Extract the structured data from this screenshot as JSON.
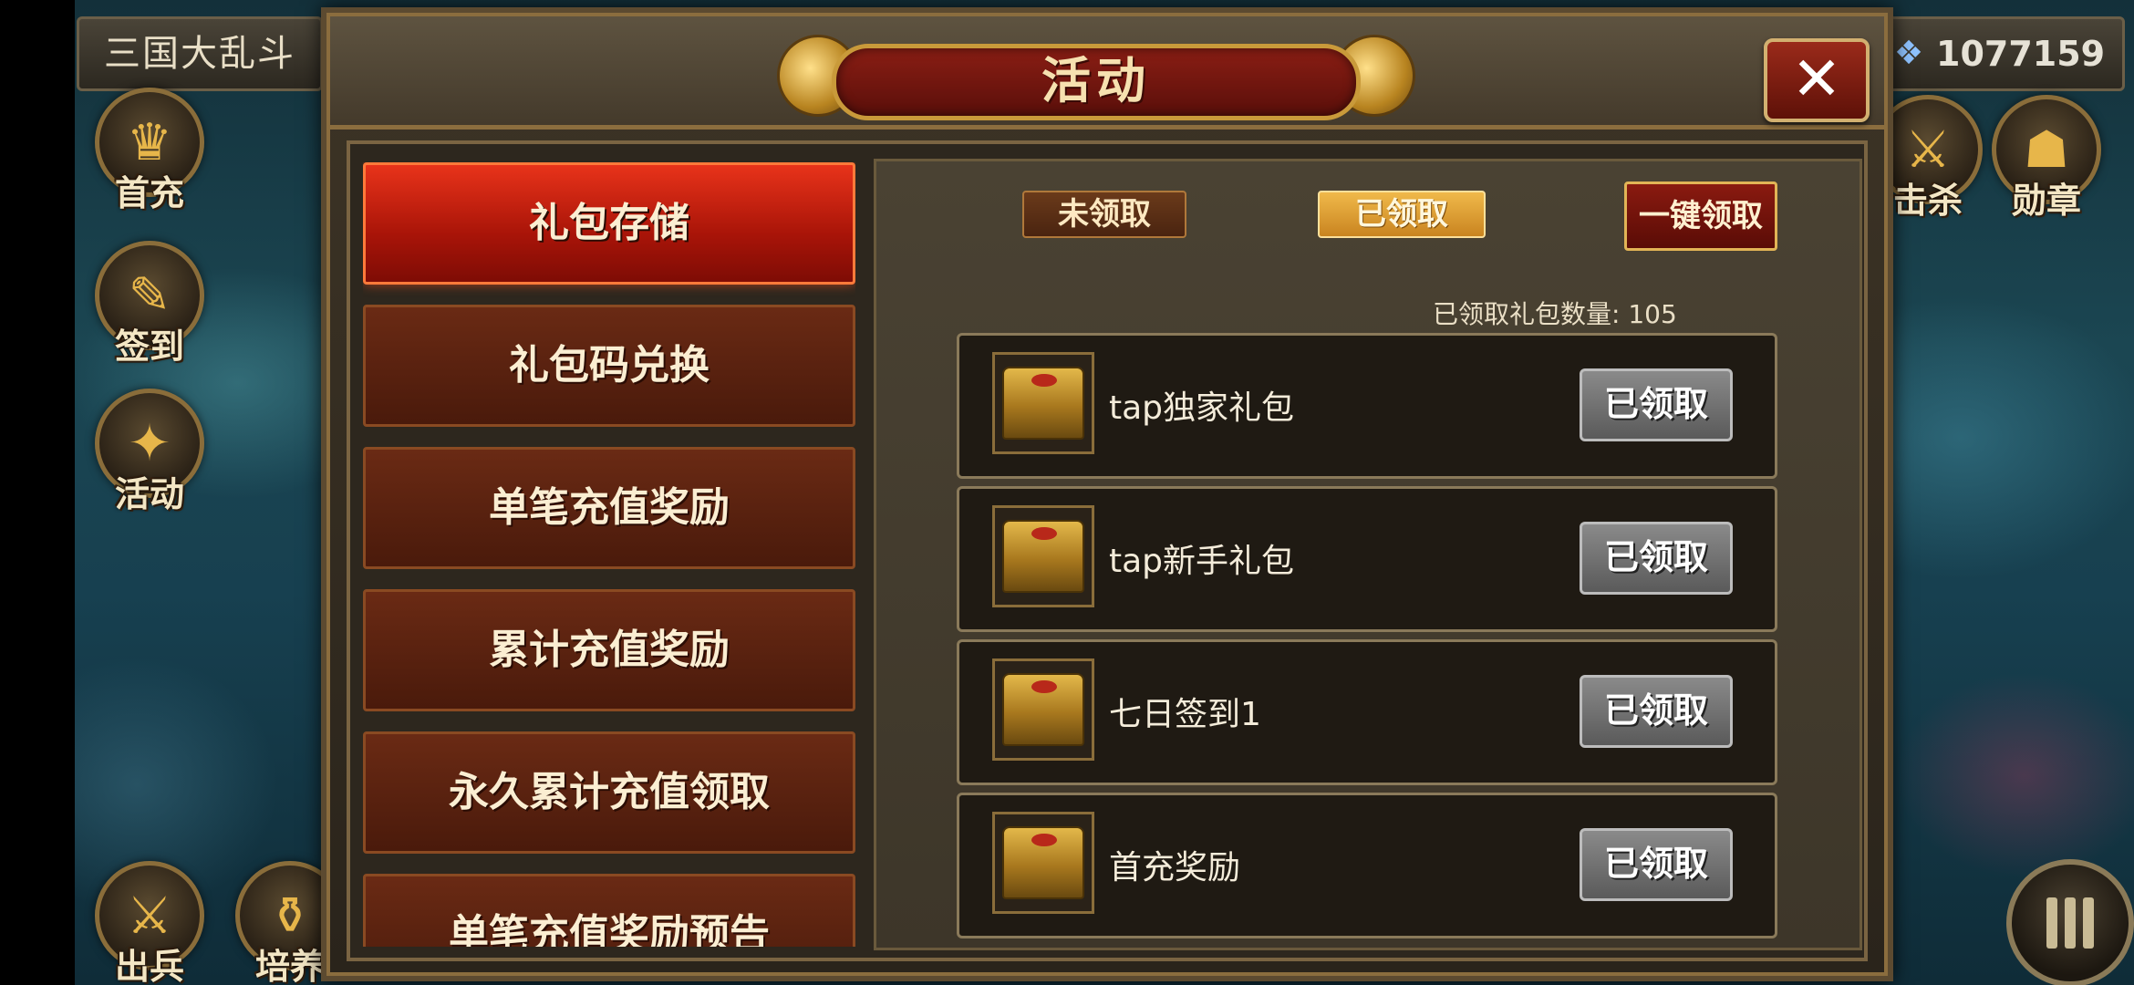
{
  "game_title": "三国大乱斗",
  "currency": {
    "icon": "gem-icon",
    "amount": "1077159"
  },
  "side_icons_left": [
    {
      "label": "首充",
      "icon": "first-charge-icon"
    },
    {
      "label": "签到",
      "icon": "checkin-icon"
    },
    {
      "label": "活动",
      "icon": "activity-icon"
    },
    {
      "label": "出兵",
      "icon": "deploy-icon"
    },
    {
      "label": "培养",
      "icon": "cultivate-icon"
    }
  ],
  "side_icons_right": [
    {
      "label": "击杀",
      "icon": "kill-icon"
    },
    {
      "label": "勋章",
      "icon": "medal-icon"
    }
  ],
  "dialog": {
    "title": "活动",
    "close": "✕",
    "tabs": [
      {
        "label": "礼包存储",
        "active": true
      },
      {
        "label": "礼包码兑换",
        "active": false
      },
      {
        "label": "单笔充值奖励",
        "active": false
      },
      {
        "label": "累计充值奖励",
        "active": false
      },
      {
        "label": "永久累计充值领取",
        "active": false
      },
      {
        "label": "单笔充值奖励预告",
        "active": false
      }
    ],
    "filters": {
      "unclaimed": "未领取",
      "claimed": "已领取"
    },
    "claim_all": "一键领取",
    "claimed_count": "已领取礼包数量: 105",
    "rewards": [
      {
        "name": "tap独家礼包",
        "status": "已领取",
        "icon": "treasure-chest-icon"
      },
      {
        "name": "tap新手礼包",
        "status": "已领取",
        "icon": "treasure-chest-icon"
      },
      {
        "name": "七日签到1",
        "status": "已领取",
        "icon": "treasure-chest-icon"
      },
      {
        "name": "首充奖励",
        "status": "已领取",
        "icon": "treasure-chest-icon"
      }
    ]
  },
  "colors": {
    "active_tab": "#c41e0e",
    "claimed_filter": "#e0a53a",
    "disabled_button": "#7a7a7a"
  }
}
